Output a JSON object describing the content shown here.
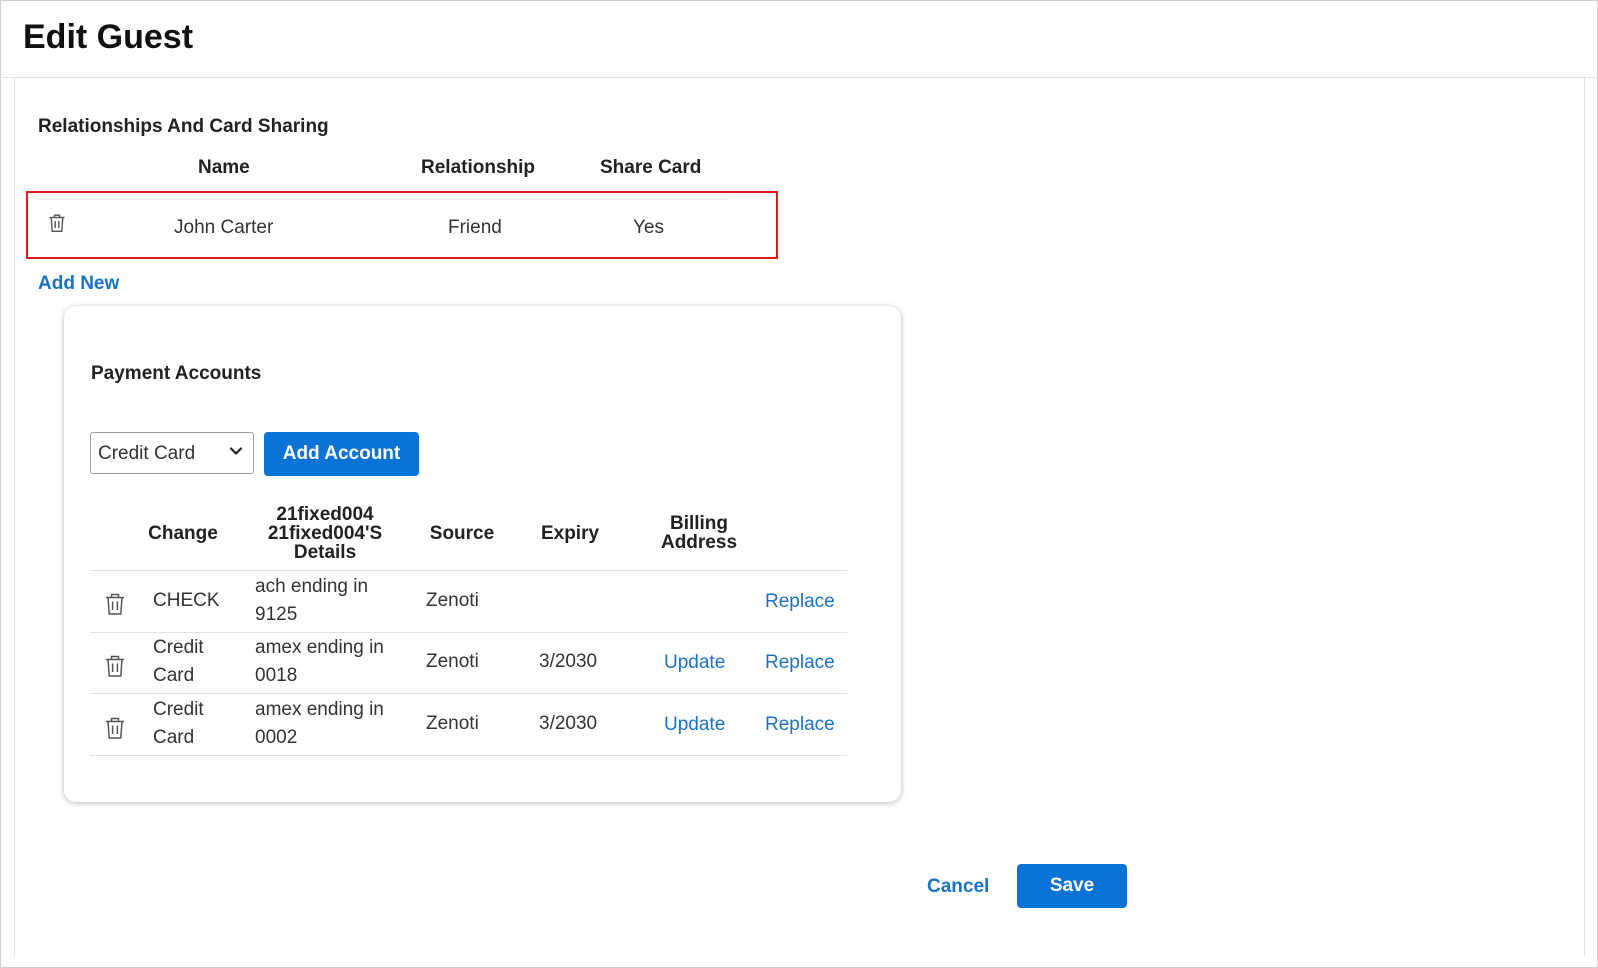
{
  "page": {
    "title": "Edit Guest"
  },
  "relationships": {
    "section_title": "Relationships And Card Sharing",
    "columns": {
      "name": "Name",
      "relationship": "Relationship",
      "share_card": "Share Card"
    },
    "rows": [
      {
        "name": "John Carter",
        "relationship": "Friend",
        "share_card": "Yes"
      }
    ],
    "add_new_label": "Add New",
    "highlight_color": "#e0191c"
  },
  "payment": {
    "section_title": "Payment Accounts",
    "account_type_select": {
      "selected": "Credit Card"
    },
    "add_account_label": "Add Account",
    "columns": {
      "change": "Change",
      "details_line1": "21fixed004",
      "details_line2": "21fixed004'S",
      "details_line3": "Details",
      "source": "Source",
      "expiry": "Expiry",
      "billing_line1": "Billing",
      "billing_line2": "Address"
    },
    "rows": [
      {
        "type_line1": "CHECK",
        "type_line2": "",
        "details_line1": "ach ending in",
        "details_line2": "9125",
        "source": "Zenoti",
        "expiry": "",
        "update_label": "",
        "replace_label": "Replace"
      },
      {
        "type_line1": "Credit",
        "type_line2": "Card",
        "details_line1": "amex ending in",
        "details_line2": "0018",
        "source": "Zenoti",
        "expiry": "3/2030",
        "update_label": "Update",
        "replace_label": "Replace"
      },
      {
        "type_line1": "Credit",
        "type_line2": "Card",
        "details_line1": "amex ending in",
        "details_line2": "0002",
        "source": "Zenoti",
        "expiry": "3/2030",
        "update_label": "Update",
        "replace_label": "Replace"
      }
    ]
  },
  "footer": {
    "cancel_label": "Cancel",
    "save_label": "Save"
  },
  "colors": {
    "accent": "#0a73d7",
    "link": "#1a73c6"
  }
}
